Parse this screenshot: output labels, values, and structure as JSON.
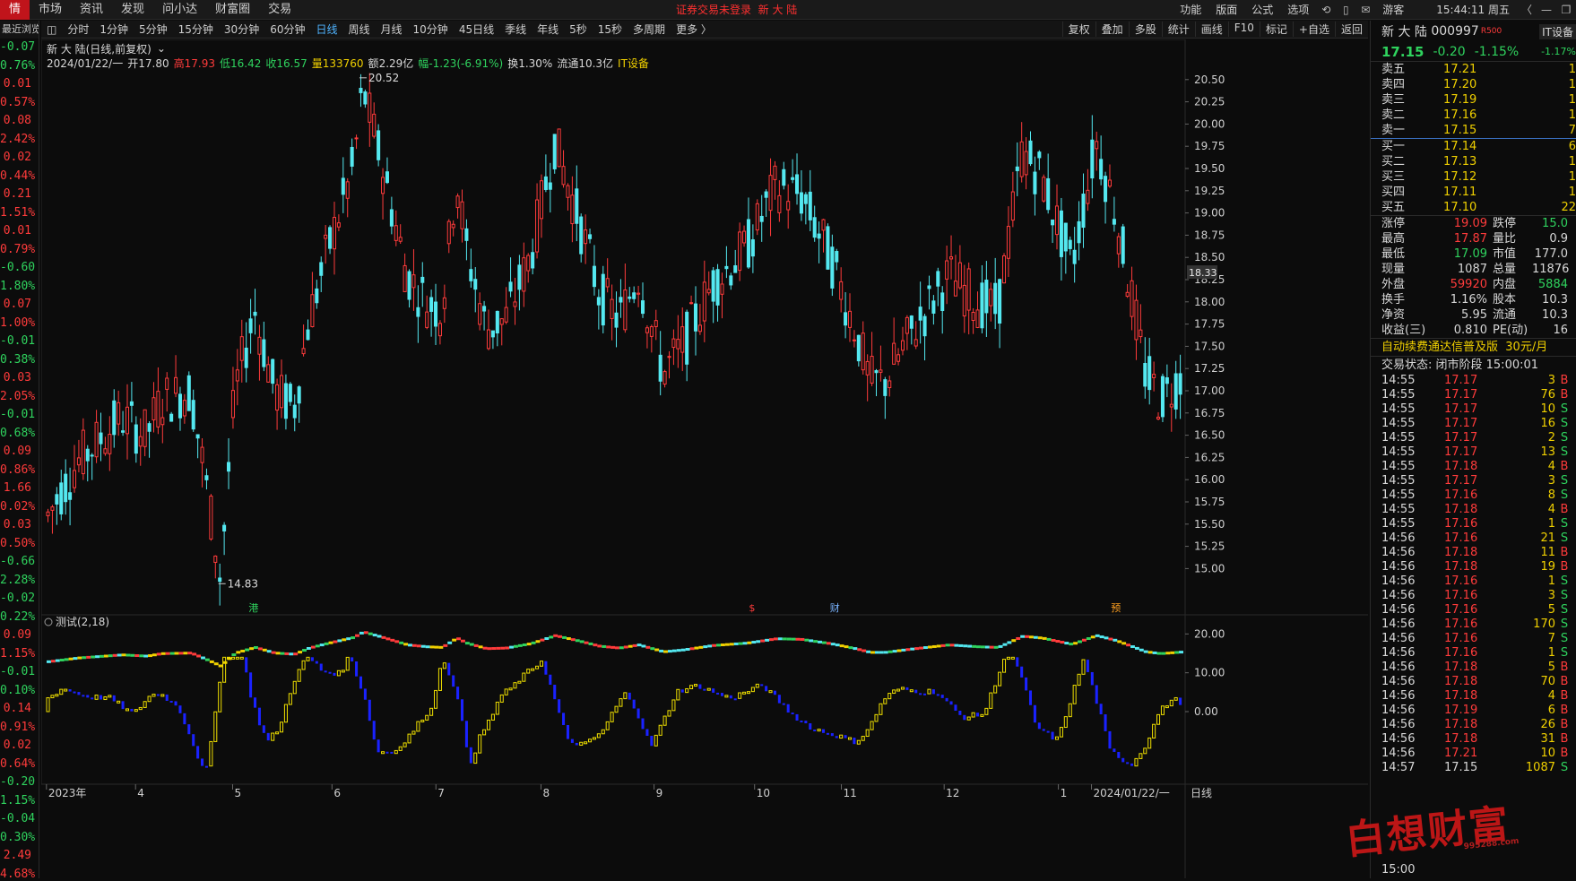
{
  "topbar": {
    "first_label": "情",
    "menus": [
      "市场",
      "资讯",
      "发现",
      "问小达",
      "财富圈",
      "交易"
    ],
    "login_status": "证券交易未登录",
    "stock_short": "新 大 陆",
    "right_menus": [
      "功能",
      "版面",
      "公式",
      "选项"
    ],
    "guest": "游客",
    "clock": "15:44:11 周五"
  },
  "toolbar": {
    "periods": [
      "分时",
      "1分钟",
      "5分钟",
      "15分钟",
      "30分钟",
      "60分钟",
      "日线",
      "周线",
      "月线",
      "10分钟",
      "45日线",
      "季线",
      "年线",
      "5秒",
      "15秒",
      "多周期",
      "更多 〉"
    ],
    "selected": "日线",
    "tools": [
      "复权",
      "叠加",
      "多股",
      "统计",
      "画线",
      "F10",
      "标记",
      "+自选",
      "返回"
    ]
  },
  "leftcol": {
    "header": "最近浏览",
    "values": [
      {
        "t": "-0.07",
        "c": "dn"
      },
      {
        "t": "0.76%",
        "c": "dn"
      },
      {
        "t": "0.01",
        "c": "up"
      },
      {
        "t": "0.57%",
        "c": "up"
      },
      {
        "t": "0.08",
        "c": "up"
      },
      {
        "t": "2.42%",
        "c": "up"
      },
      {
        "t": "0.02",
        "c": "up"
      },
      {
        "t": "0.44%",
        "c": "up"
      },
      {
        "t": "0.21",
        "c": "up"
      },
      {
        "t": "1.51%",
        "c": "up"
      },
      {
        "t": "0.01",
        "c": "up"
      },
      {
        "t": "0.79%",
        "c": "up"
      },
      {
        "t": "-0.60",
        "c": "dn"
      },
      {
        "t": "1.80%",
        "c": "dn"
      },
      {
        "t": "0.07",
        "c": "up"
      },
      {
        "t": "1.00%",
        "c": "up"
      },
      {
        "t": "-0.01",
        "c": "dn"
      },
      {
        "t": "0.38%",
        "c": "dn"
      },
      {
        "t": "0.03",
        "c": "up"
      },
      {
        "t": "2.05%",
        "c": "up"
      },
      {
        "t": "-0.01",
        "c": "dn"
      },
      {
        "t": "0.68%",
        "c": "dn"
      },
      {
        "t": "0.09",
        "c": "up"
      },
      {
        "t": "0.86%",
        "c": "up"
      },
      {
        "t": "1.66",
        "c": "up"
      },
      {
        "t": "0.02%",
        "c": "up"
      },
      {
        "t": "0.03",
        "c": "up"
      },
      {
        "t": "0.50%",
        "c": "up"
      },
      {
        "t": "-0.66",
        "c": "dn"
      },
      {
        "t": "2.28%",
        "c": "dn"
      },
      {
        "t": "-0.02",
        "c": "dn"
      },
      {
        "t": "0.22%",
        "c": "dn"
      },
      {
        "t": "0.09",
        "c": "up"
      },
      {
        "t": "1.15%",
        "c": "up"
      },
      {
        "t": "-0.01",
        "c": "dn"
      },
      {
        "t": "0.10%",
        "c": "dn"
      },
      {
        "t": "0.14",
        "c": "up"
      },
      {
        "t": "0.91%",
        "c": "up"
      },
      {
        "t": "0.02",
        "c": "up"
      },
      {
        "t": "0.64%",
        "c": "up"
      },
      {
        "t": "-0.20",
        "c": "dn"
      },
      {
        "t": "1.15%",
        "c": "dn"
      },
      {
        "t": "-0.04",
        "c": "dn"
      },
      {
        "t": "0.30%",
        "c": "dn"
      },
      {
        "t": "2.49",
        "c": "up"
      },
      {
        "t": "4.68%",
        "c": "up"
      }
    ]
  },
  "chart_header": {
    "title": "新 大 陆(日线,前复权)",
    "date": "2024/01/22/一",
    "open_label": "开",
    "open": "17.80",
    "high_label": "高",
    "high": "17.93",
    "low_label": "低",
    "low": "16.42",
    "close_label": "收",
    "close": "16.57",
    "vol_label": "量",
    "vol": "133760",
    "amt_label": "额",
    "amt": "2.29亿",
    "chg_label": "幅",
    "chg": "-1.23(-6.91%)",
    "turnover": "换1.30%",
    "float_cap": "流通10.3亿",
    "sector": "IT设备"
  },
  "chart_data": {
    "type": "candlestick",
    "price_axis": {
      "min": 14.5,
      "max": 20.75,
      "ticks": [
        "20.50",
        "20.25",
        "20.00",
        "19.75",
        "19.50",
        "19.25",
        "19.00",
        "18.75",
        "18.50",
        "18.25",
        "18.00",
        "17.75",
        "17.50",
        "17.25",
        "17.00",
        "16.75",
        "16.50",
        "16.25",
        "16.00",
        "15.75",
        "15.50",
        "15.25",
        "15.00"
      ]
    },
    "crosshair_price": "18.33",
    "max_label": "20.52",
    "min_label": "14.83",
    "month_labels": [
      [
        "2023年",
        0.003
      ],
      [
        "4",
        0.081
      ],
      [
        "5",
        0.166
      ],
      [
        "6",
        0.253
      ],
      [
        "7",
        0.344
      ],
      [
        "8",
        0.436
      ],
      [
        "9",
        0.535
      ],
      [
        "10",
        0.623
      ],
      [
        "11",
        0.699
      ],
      [
        "12",
        0.789
      ],
      [
        "1",
        0.889
      ],
      [
        "2024/01/22/一",
        0.918
      ]
    ],
    "event_marks": [
      {
        "t": "港",
        "c": "#2fd35e",
        "x": 0.18
      },
      {
        "t": "$",
        "c": "#ff3b3b",
        "x": 0.618
      },
      {
        "t": "财",
        "c": "#7ab4ff",
        "x": 0.689
      },
      {
        "t": "预",
        "c": "#ffa020",
        "x": 0.935
      }
    ],
    "indicator": {
      "name": "测试(2,18)",
      "axis_ticks": [
        "20.00",
        "10.00",
        "0.00"
      ],
      "min": -15,
      "max": 24
    },
    "bottom_label": "日线"
  },
  "quote": {
    "name": "新 大 陆",
    "code": "000997",
    "r_tag": "R500",
    "sector_tag": "IT设备",
    "price": "17.15",
    "change": "-0.20",
    "pct": "-1.15%",
    "sector_pct": "-1.17%",
    "asks": [
      [
        "卖五",
        "17.21",
        "1"
      ],
      [
        "卖四",
        "17.20",
        "1"
      ],
      [
        "卖三",
        "17.19",
        "1"
      ],
      [
        "卖二",
        "17.16",
        "1"
      ],
      [
        "卖一",
        "17.15",
        "7"
      ]
    ],
    "bids": [
      [
        "买一",
        "17.14",
        "6"
      ],
      [
        "买二",
        "17.13",
        "1"
      ],
      [
        "买三",
        "17.12",
        "1"
      ],
      [
        "买四",
        "17.11",
        "1"
      ],
      [
        "买五",
        "17.10",
        "22"
      ]
    ],
    "stats": [
      [
        "涨停",
        "19.09",
        "up",
        "跌停",
        "15.0",
        "dn"
      ],
      [
        "最高",
        "17.87",
        "up",
        "量比",
        "0.9",
        "wh"
      ],
      [
        "最低",
        "17.09",
        "dn",
        "市值",
        "177.0",
        "wh"
      ],
      [
        "现量",
        "1087",
        "wh",
        "总量",
        "11876",
        "wh"
      ],
      [
        "外盘",
        "59920",
        "up",
        "内盘",
        "5884",
        "dn"
      ],
      [
        "换手",
        "1.16%",
        "wh",
        "股本",
        "10.3",
        "wh"
      ],
      [
        "净资",
        "5.95",
        "wh",
        "流通",
        "10.3",
        "wh"
      ],
      [
        "收益(三)",
        "0.810",
        "wh",
        "PE(动)",
        "16",
        "wh"
      ]
    ],
    "promo": "自动续费通达信普及版",
    "promo_price": "30元/月",
    "trade_status": "交易状态: 闭市阶段 15:00:01",
    "ticks": [
      [
        "14:55",
        "17.17",
        "3",
        "B"
      ],
      [
        "14:55",
        "17.17",
        "76",
        "B"
      ],
      [
        "14:55",
        "17.17",
        "10",
        "S"
      ],
      [
        "14:55",
        "17.17",
        "16",
        "S"
      ],
      [
        "14:55",
        "17.17",
        "2",
        "S"
      ],
      [
        "14:55",
        "17.17",
        "13",
        "S"
      ],
      [
        "14:55",
        "17.18",
        "4",
        "B"
      ],
      [
        "14:55",
        "17.17",
        "3",
        "S"
      ],
      [
        "14:55",
        "17.16",
        "8",
        "S"
      ],
      [
        "14:55",
        "17.18",
        "4",
        "B"
      ],
      [
        "14:55",
        "17.16",
        "1",
        "S"
      ],
      [
        "14:56",
        "17.16",
        "21",
        "S"
      ],
      [
        "14:56",
        "17.18",
        "11",
        "B"
      ],
      [
        "14:56",
        "17.18",
        "19",
        "B"
      ],
      [
        "14:56",
        "17.16",
        "1",
        "S"
      ],
      [
        "14:56",
        "17.16",
        "3",
        "S"
      ],
      [
        "14:56",
        "17.16",
        "5",
        "S"
      ],
      [
        "14:56",
        "17.16",
        "170",
        "S"
      ],
      [
        "14:56",
        "17.16",
        "7",
        "S"
      ],
      [
        "14:56",
        "17.16",
        "1",
        "S"
      ],
      [
        "14:56",
        "17.18",
        "5",
        "B"
      ],
      [
        "14:56",
        "17.18",
        "70",
        "B"
      ],
      [
        "14:56",
        "17.18",
        "4",
        "B"
      ],
      [
        "14:56",
        "17.19",
        "6",
        "B"
      ],
      [
        "14:56",
        "17.18",
        "26",
        "B"
      ],
      [
        "14:56",
        "17.18",
        "31",
        "B"
      ],
      [
        "14:56",
        "17.21",
        "10",
        "B"
      ],
      [
        "14:57",
        "17.15",
        "1087",
        "S"
      ]
    ],
    "bottom_time": "15:00"
  },
  "watermark": {
    "text": "白想财富",
    "url": "995288.com"
  }
}
